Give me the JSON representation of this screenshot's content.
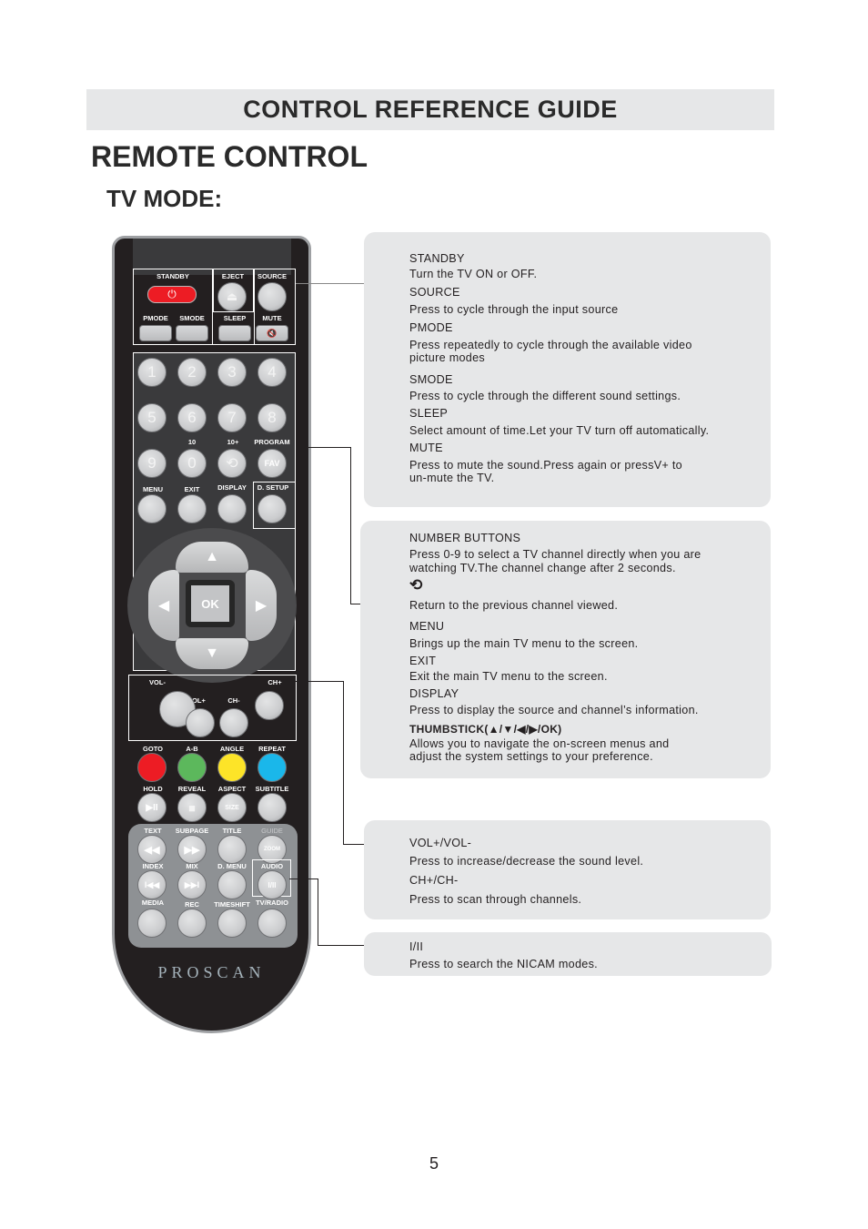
{
  "header": {
    "banner": "CONTROL REFERENCE GUIDE",
    "title": "REMOTE CONTROL",
    "subtitle": "TV MODE:"
  },
  "remote": {
    "brand": "PROSCAN",
    "labels": {
      "standby": "STANDBY",
      "eject": "EJECT",
      "source": "SOURCE",
      "pmode": "PMODE",
      "smode": "SMODE",
      "sleep": "SLEEP",
      "mute": "MUTE",
      "ten": "10",
      "tenplus": "10+",
      "program": "PROGRAM",
      "menu": "MENU",
      "exit": "EXIT",
      "display": "DISPLAY",
      "dsetup": "D. SETUP",
      "volminus": "VOL-",
      "volplus": "VOL+",
      "chminus": "CH-",
      "chplus": "CH+",
      "goto": "GOTO",
      "ab": "A-B",
      "angle": "ANGLE",
      "repeat": "REPEAT",
      "hold": "HOLD",
      "reveal": "REVEAL",
      "aspect": "ASPECT",
      "subtitle": "SUBTITLE",
      "text": "TEXT",
      "subpage": "SUBPAGE",
      "title": "TITLE",
      "guide": "GUIDE",
      "index": "INDEX",
      "mix": "MIX",
      "dmenu": "D. MENU",
      "audio": "AUDIO",
      "media": "MEDIA",
      "rec": "REC",
      "timeshift": "TIMESHIFT",
      "tvradio": "TV/RADIO"
    },
    "numbers": [
      "1",
      "2",
      "3",
      "4",
      "5",
      "6",
      "7",
      "8",
      "9",
      "0"
    ],
    "button_glyphs": {
      "power": "⏻",
      "eject": "⏏",
      "mute": "🔇",
      "recall": "⟲",
      "fav": "FAV",
      "ok": "OK",
      "up": "▲",
      "down": "▼",
      "left": "◀",
      "right": "▶",
      "hold": "▶II",
      "reveal": "■",
      "aspect": "SIZE",
      "rewind": "◀◀",
      "forward": "▶▶",
      "zoom": "ZOOM",
      "prev": "I◀◀",
      "next": "▶▶I",
      "audio": "I/II"
    },
    "color_buttons": {
      "red": "#ed1c24",
      "green": "#5cb85c",
      "yellow": "#fde428",
      "blue": "#1ab7ea"
    }
  },
  "info": {
    "box1": [
      {
        "text": "STANDBY",
        "bold": false
      },
      {
        "text": "Turn the TV ON or OFF.",
        "bold": false
      },
      {
        "text": "SOURCE",
        "bold": false
      },
      {
        "text": "Press to cycle through the input source",
        "bold": false
      },
      {
        "text": "PMODE",
        "bold": false
      },
      {
        "text": "Press repeatedly to cycle through the available video",
        "bold": false
      },
      {
        "text": "picture modes",
        "bold": false
      },
      {
        "text": "SMODE",
        "bold": false
      },
      {
        "text": "Press to cycle through the different sound settings.",
        "bold": false
      },
      {
        "text": "SLEEP",
        "bold": false
      },
      {
        "text": "Select amount of time.Let your TV turn off automatically.",
        "bold": false
      },
      {
        "text": "MUTE",
        "bold": false
      },
      {
        "text": "Press to mute the sound.Press again or pressV+ to",
        "bold": false
      },
      {
        "text": "un-mute the TV.",
        "bold": false
      }
    ],
    "box2": [
      {
        "text": "NUMBER BUTTONS",
        "bold": false
      },
      {
        "text": "Press 0-9 to select a TV channel directly when you are",
        "bold": false
      },
      {
        "text": "watching TV.The channel change after 2 seconds.",
        "bold": false
      },
      {
        "text": "⟲",
        "bold": true
      },
      {
        "text": "Return to the previous channel viewed.",
        "bold": false
      },
      {
        "text": "MENU",
        "bold": false
      },
      {
        "text": "Brings up the main TV menu to the screen.",
        "bold": false
      },
      {
        "text": "EXIT",
        "bold": false
      },
      {
        "text": "Exit the main TV menu to the screen.",
        "bold": false
      },
      {
        "text": "DISPLAY",
        "bold": false
      },
      {
        "text": "Press to display the source and channel’s information.",
        "bold": false
      },
      {
        "text": "THUMBSTICK(▲/▼/◀/▶/OK)",
        "bold": true
      },
      {
        "text": "Allows you to navigate the on-screen menus and",
        "bold": false
      },
      {
        "text": "adjust the system settings to your preference.",
        "bold": false
      }
    ],
    "box3": [
      {
        "text": "VOL+/VOL-",
        "bold": false
      },
      {
        "text": "Press to increase/decrease the sound level.",
        "bold": false
      },
      {
        "text": "CH+/CH-",
        "bold": false
      },
      {
        "text": "Press to scan through channels.",
        "bold": false
      }
    ],
    "box4": [
      {
        "text": "I/II",
        "bold": false
      },
      {
        "text": "Press to search the NICAM modes.",
        "bold": false
      }
    ]
  },
  "footer": {
    "page_number": "5"
  }
}
